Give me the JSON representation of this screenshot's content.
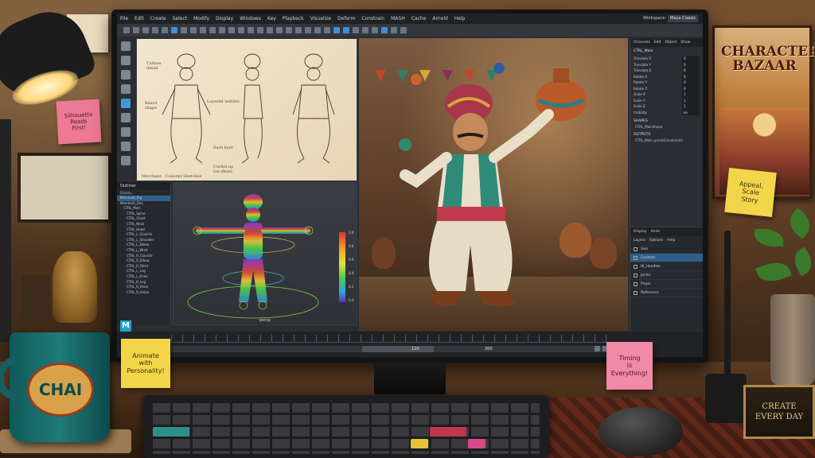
{
  "app": {
    "menu": [
      "File",
      "Edit",
      "Create",
      "Select",
      "Modify",
      "Display",
      "Windows",
      "Key",
      "Playback",
      "Visualize",
      "Deform",
      "Constrain",
      "MASH",
      "Cache",
      "Arnold",
      "Help"
    ],
    "workspace_label": "Workspace:",
    "workspace_value": "Maya Classic",
    "logo": "M"
  },
  "sketch": {
    "notes": [
      "Turban\ndetail",
      "Beard\nshape",
      "Layered textiles",
      "Sash knot",
      "Curled up\ntoe shoes"
    ],
    "caption": "Merchant - Concept Sketches"
  },
  "outliner": {
    "title": "Outliner",
    "subtitle": "Display",
    "rows": [
      "Merchant_Rig",
      "Merchant_Geo",
      "CTRL_Main",
      "CTRL_Spine",
      "CTRL_Chest",
      "CTRL_Neck",
      "CTRL_Head",
      "CTRL_L_Clavicle",
      "CTRL_L_Shoulder",
      "CTRL_L_Elbow",
      "CTRL_L_Wrist",
      "CTRL_R_Clavicle",
      "CTRL_R_Elbow",
      "CTRL_R_Wrist",
      "CTRL_L_Leg",
      "CTRL_L_Knee",
      "CTRL_R_Leg",
      "CTRL_R_Knee",
      "CTRL_R_Ankle"
    ]
  },
  "rig_view": {
    "camera": "persp",
    "colorbar_ticks": [
      "1.0",
      "0.8",
      "0.6",
      "0.4",
      "0.2",
      "0.0"
    ]
  },
  "channel_box": {
    "tabs": [
      "Channels",
      "Edit",
      "Object",
      "Show"
    ],
    "object": "CTRL_Main",
    "attributes": [
      {
        "name": "Translate X",
        "value": "0"
      },
      {
        "name": "Translate Y",
        "value": "0"
      },
      {
        "name": "Translate Z",
        "value": "0"
      },
      {
        "name": "Rotate X",
        "value": "0"
      },
      {
        "name": "Rotate Y",
        "value": "0"
      },
      {
        "name": "Rotate Z",
        "value": "0"
      },
      {
        "name": "Scale X",
        "value": "1"
      },
      {
        "name": "Scale Y",
        "value": "1"
      },
      {
        "name": "Scale Z",
        "value": "1"
      },
      {
        "name": "Visibility",
        "value": "on"
      }
    ],
    "shapes_header": "SHAPES",
    "shapes_item": "CTRL_MainShape",
    "outputs_header": "OUTPUTS",
    "outputs_item": "CTRL_Main_parentConstraint1"
  },
  "layer_editor": {
    "tabs": [
      "Display",
      "Anim"
    ],
    "menu": [
      "Layers",
      "Options",
      "Help"
    ],
    "layers": [
      {
        "name": "Geo",
        "selected": false
      },
      {
        "name": "Controls",
        "selected": true
      },
      {
        "name": "IK_Handles",
        "selected": false
      },
      {
        "name": "Joints",
        "selected": false
      },
      {
        "name": "Props",
        "selected": false
      },
      {
        "name": "Reference",
        "selected": false
      }
    ]
  },
  "timeline": {
    "start": "1",
    "range_start": "120",
    "range_end": "200"
  },
  "notes": {
    "wall_sticky": "Silhouette\nReads\nFirst!",
    "poster_title": "CHARACTER\nBAZAAR",
    "right_sticky": "Appeal,\nScale\nStory",
    "sticky_animate": "Animate\nwith\nPersonality!",
    "sticky_timing": "Timing\nis\nEverything!",
    "mug_text": "CHAI",
    "plaque": "CREATE\nEVERY DAY"
  },
  "colors": {
    "accent_blue": "#3f8fd6",
    "selection": "#2f5f8c",
    "sticky_yellow": "#f3d54a",
    "sticky_pink": "#f08aa6",
    "maya_teal": "#1ca7c6"
  }
}
